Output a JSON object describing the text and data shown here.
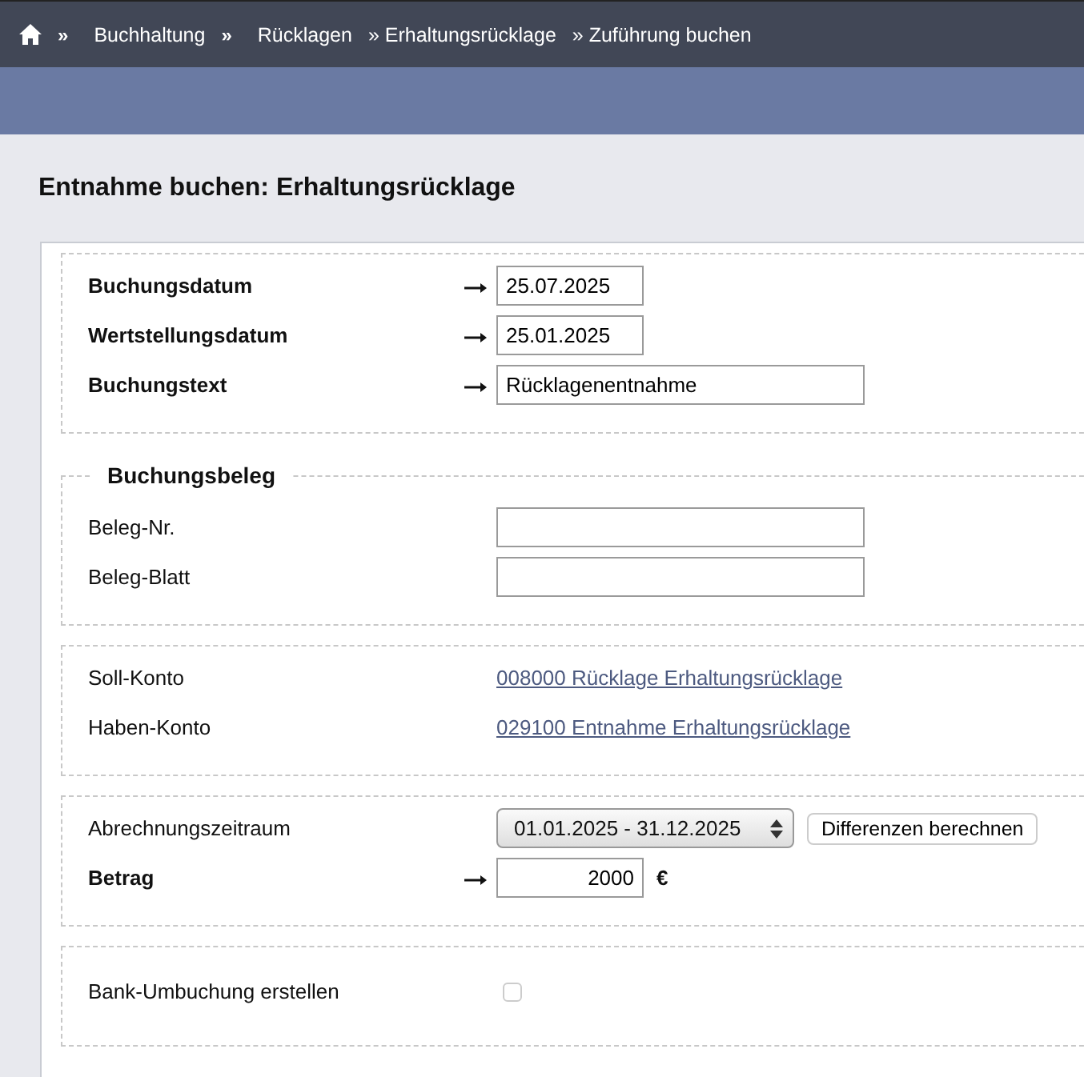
{
  "breadcrumb": [
    {
      "kind": "separator",
      "text": "»"
    },
    {
      "kind": "link",
      "text": "Buchhaltung"
    },
    {
      "kind": "separator",
      "text": "»"
    },
    {
      "kind": "link",
      "text": "Rücklagen"
    },
    {
      "kind": "link",
      "text": "» Erhaltungsrücklage"
    },
    {
      "kind": "link",
      "text": "» Zuführung buchen"
    }
  ],
  "title": "Entnahme buchen: Erhaltungsrücklage",
  "sections": [
    {
      "rows": [
        {
          "kind": "date",
          "label": "Buchungsdatum",
          "required": true,
          "value": "25.07.2025"
        },
        {
          "kind": "date",
          "label": "Wertstellungsdatum",
          "required": true,
          "value": "25.01.2025"
        },
        {
          "kind": "text",
          "label": "Buchungstext",
          "required": true,
          "value": "Rücklagenentnahme"
        }
      ]
    },
    {
      "legend": "Buchungsbeleg",
      "rows": [
        {
          "kind": "text",
          "label": "Beleg-Nr.",
          "required": false
        },
        {
          "kind": "text",
          "label": "Beleg-Blatt",
          "required": false
        }
      ]
    },
    {
      "rows": [
        {
          "kind": "link",
          "label": "Soll-Konto",
          "required": false,
          "value": "008000 Rücklage Erhaltungsrücklage"
        },
        {
          "kind": "link",
          "label": "Haben-Konto",
          "required": false,
          "value": "029100 Entnahme Erhaltungsrücklage"
        }
      ]
    },
    {
      "rows": [
        {
          "kind": "select",
          "label": "Abrechnungszeitraum",
          "required": false,
          "value": "01.01.2025 - 31.12.2025",
          "button": "Differenzen berechnen"
        },
        {
          "kind": "amount",
          "label": "Betrag",
          "required": true,
          "value": "2000",
          "unit": "€"
        }
      ]
    },
    {
      "rows": [
        {
          "kind": "checkbox",
          "label": "Bank-Umbuchung erstellen",
          "required": false,
          "checked": false
        }
      ]
    }
  ]
}
